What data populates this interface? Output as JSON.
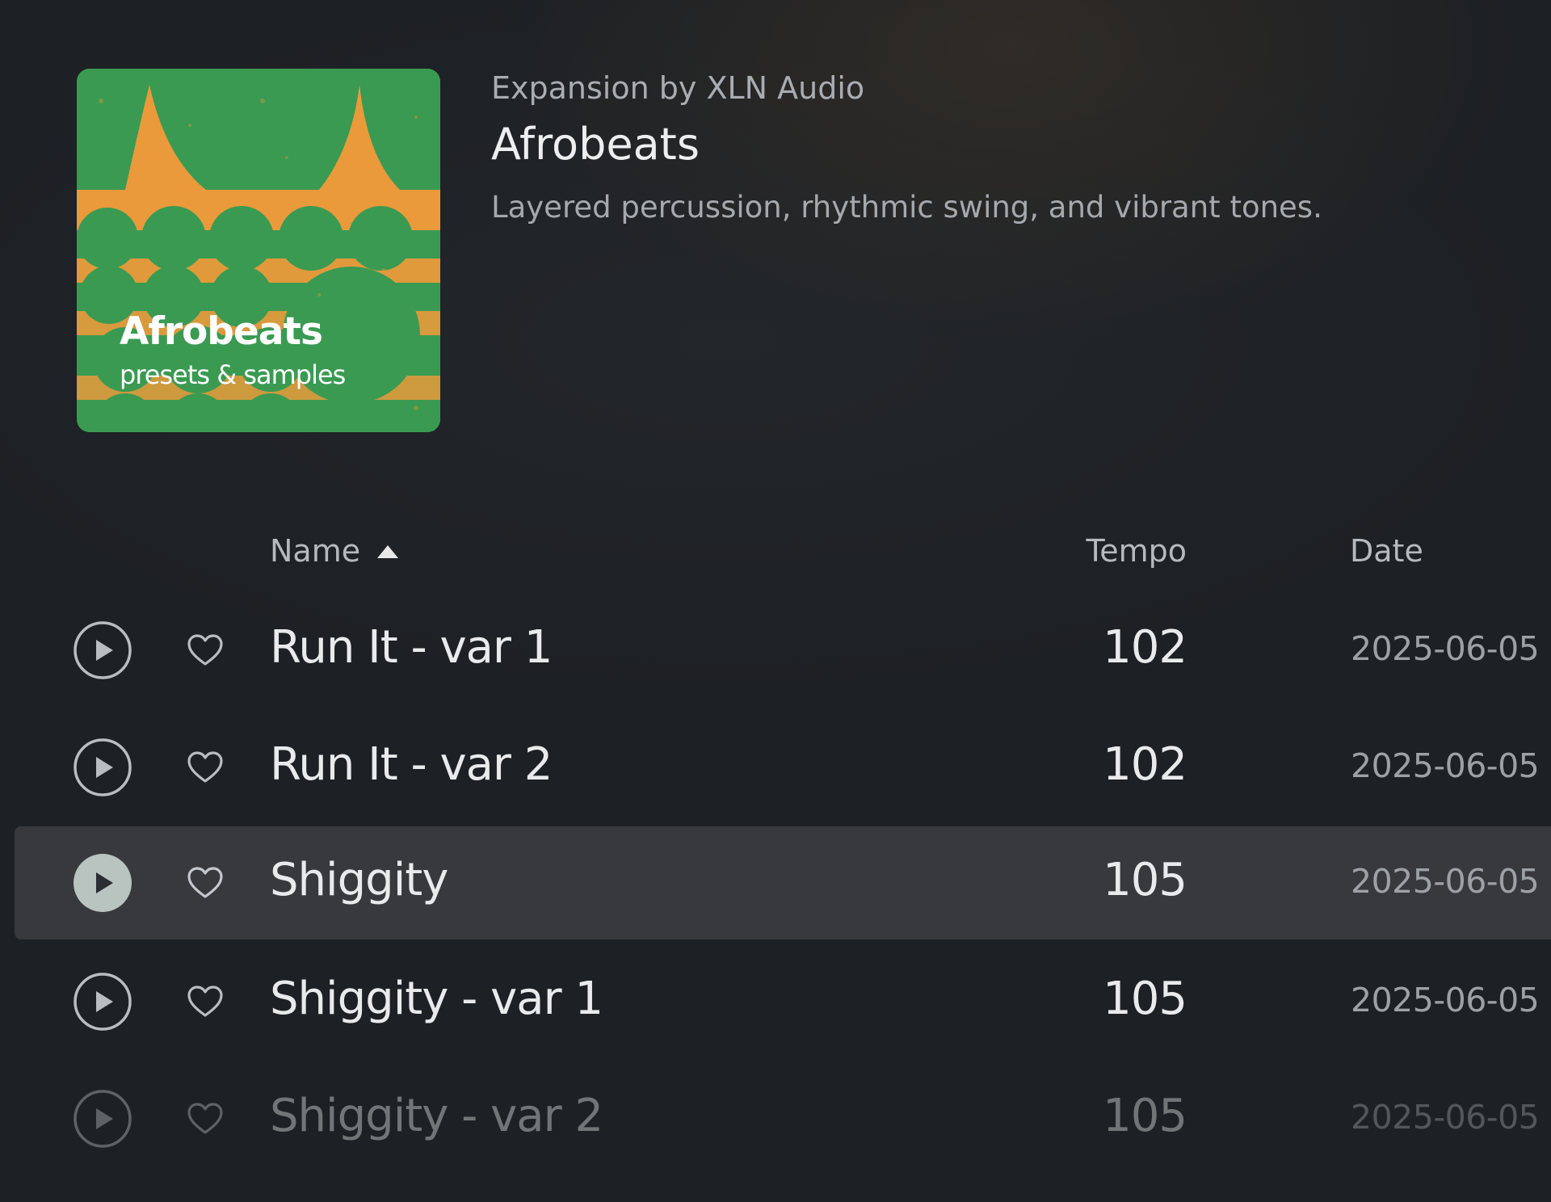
{
  "pack": {
    "by_line": "Expansion by XLN Audio",
    "title": "Afrobeats",
    "description": "Layered percussion, rhythmic swing, and vibrant tones.",
    "cover": {
      "title": "Afrobeats",
      "subtitle": "presets & samples",
      "colors": {
        "green": "#3a9a52",
        "orange": "#f39a3a"
      }
    }
  },
  "table": {
    "columns": {
      "name": "Name",
      "tempo": "Tempo",
      "date": "Date"
    },
    "sort": {
      "column": "name",
      "direction": "ascending",
      "icon": "sort-ascending-triangle-icon"
    },
    "rows": [
      {
        "name": "Run It - var 1",
        "tempo": "102",
        "date": "2025-06-05"
      },
      {
        "name": "Run It - var 2",
        "tempo": "102",
        "date": "2025-06-05"
      },
      {
        "name": "Shiggity",
        "tempo": "105",
        "date": "2025-06-05"
      },
      {
        "name": "Shiggity - var 1",
        "tempo": "105",
        "date": "2025-06-05"
      },
      {
        "name": "Shiggity - var 2",
        "tempo": "105",
        "date": "2025-06-05"
      }
    ],
    "selected_row": "Shiggity",
    "icons": {
      "play": "play-icon",
      "favorite": "heart-icon"
    }
  },
  "theme": {
    "background": "#1d2024",
    "selected_row": "#37393d",
    "text_primary": "#e8eaec",
    "text_secondary": "#a5a9ad"
  }
}
